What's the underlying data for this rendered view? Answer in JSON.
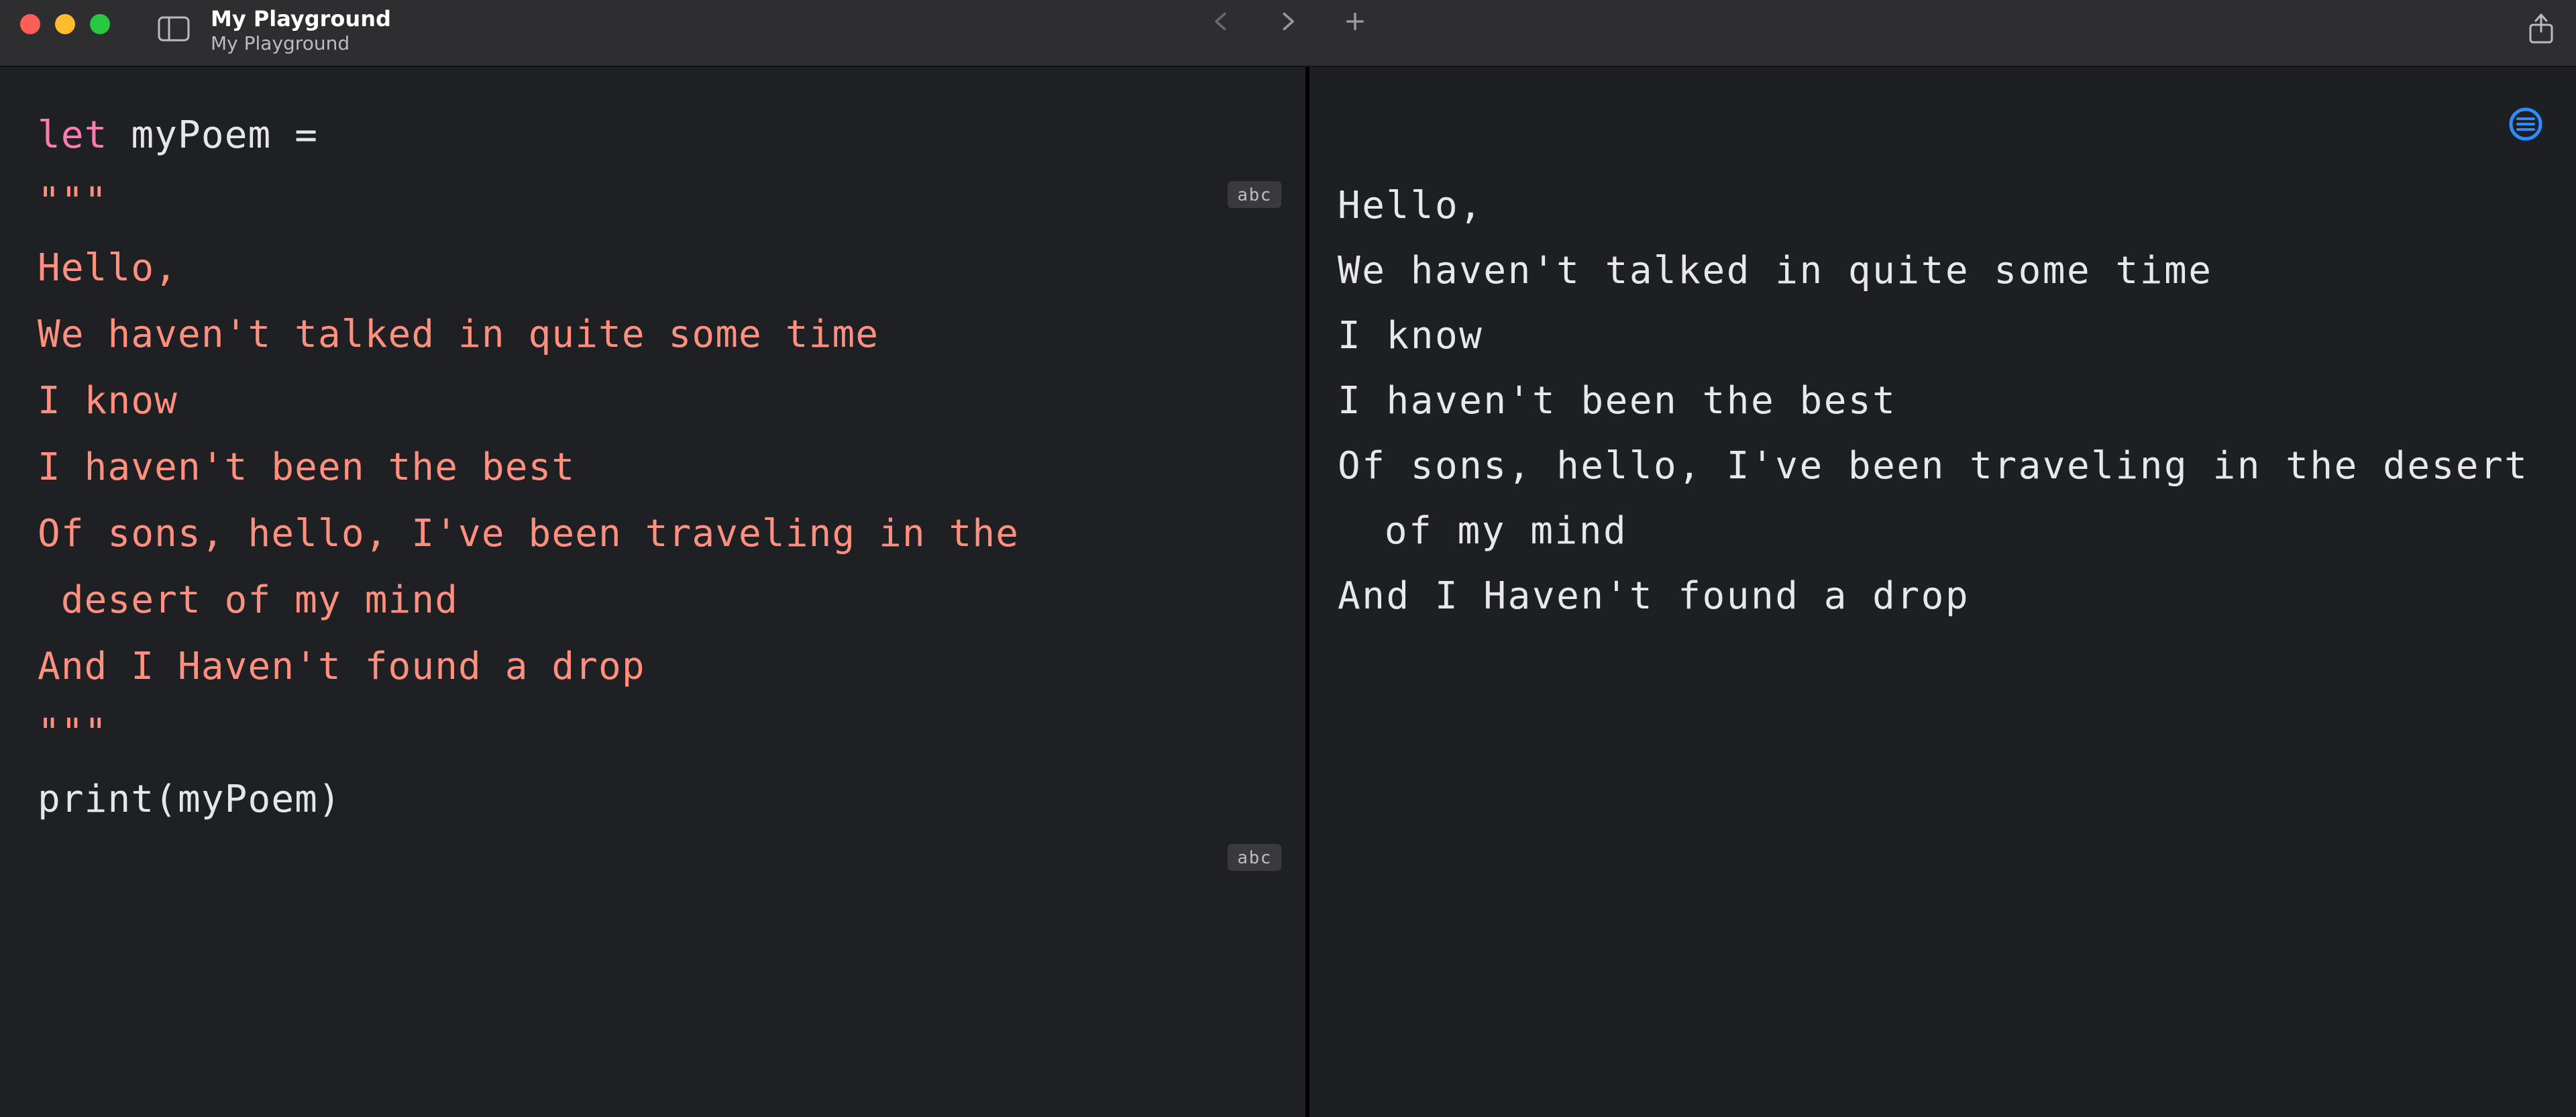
{
  "window": {
    "title": "My Playground",
    "subtitle": "My Playground"
  },
  "toolbar": {
    "back_enabled": false,
    "forward_enabled": true
  },
  "editor": {
    "keyword_let": "let",
    "decl_rest": " myPoem =",
    "triple_open": "\"\"\"",
    "poem_lines": [
      "Hello,",
      "We haven't talked in quite some time",
      "I know",
      "I haven't been the best"
    ],
    "poem_wrap_first": "Of sons, hello, I've been traveling in the",
    "poem_wrap_second": " desert of my mind",
    "poem_last": "And I Haven't found a drop",
    "triple_close": "\"\"\"",
    "print_stmt": "print(myPoem)",
    "result_badge_1": "abc",
    "result_badge_2": "abc"
  },
  "output": {
    "lines": [
      "Hello,",
      "We haven't talked in quite some time",
      "I know",
      "I haven't been the best"
    ],
    "wrap_first": "Of sons, hello, I've been traveling in the desert",
    "wrap_second": " of my mind",
    "last": "And I Haven't found a drop"
  }
}
